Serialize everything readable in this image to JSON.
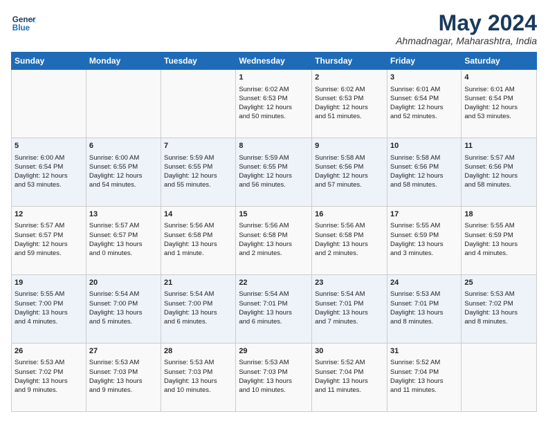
{
  "header": {
    "logo_line1": "General",
    "logo_line2": "Blue",
    "month_title": "May 2024",
    "location": "Ahmadnagar, Maharashtra, India"
  },
  "days_of_week": [
    "Sunday",
    "Monday",
    "Tuesday",
    "Wednesday",
    "Thursday",
    "Friday",
    "Saturday"
  ],
  "weeks": [
    [
      {
        "day": "",
        "info": ""
      },
      {
        "day": "",
        "info": ""
      },
      {
        "day": "",
        "info": ""
      },
      {
        "day": "1",
        "info": "Sunrise: 6:02 AM\nSunset: 6:53 PM\nDaylight: 12 hours\nand 50 minutes."
      },
      {
        "day": "2",
        "info": "Sunrise: 6:02 AM\nSunset: 6:53 PM\nDaylight: 12 hours\nand 51 minutes."
      },
      {
        "day": "3",
        "info": "Sunrise: 6:01 AM\nSunset: 6:54 PM\nDaylight: 12 hours\nand 52 minutes."
      },
      {
        "day": "4",
        "info": "Sunrise: 6:01 AM\nSunset: 6:54 PM\nDaylight: 12 hours\nand 53 minutes."
      }
    ],
    [
      {
        "day": "5",
        "info": "Sunrise: 6:00 AM\nSunset: 6:54 PM\nDaylight: 12 hours\nand 53 minutes."
      },
      {
        "day": "6",
        "info": "Sunrise: 6:00 AM\nSunset: 6:55 PM\nDaylight: 12 hours\nand 54 minutes."
      },
      {
        "day": "7",
        "info": "Sunrise: 5:59 AM\nSunset: 6:55 PM\nDaylight: 12 hours\nand 55 minutes."
      },
      {
        "day": "8",
        "info": "Sunrise: 5:59 AM\nSunset: 6:55 PM\nDaylight: 12 hours\nand 56 minutes."
      },
      {
        "day": "9",
        "info": "Sunrise: 5:58 AM\nSunset: 6:56 PM\nDaylight: 12 hours\nand 57 minutes."
      },
      {
        "day": "10",
        "info": "Sunrise: 5:58 AM\nSunset: 6:56 PM\nDaylight: 12 hours\nand 58 minutes."
      },
      {
        "day": "11",
        "info": "Sunrise: 5:57 AM\nSunset: 6:56 PM\nDaylight: 12 hours\nand 58 minutes."
      }
    ],
    [
      {
        "day": "12",
        "info": "Sunrise: 5:57 AM\nSunset: 6:57 PM\nDaylight: 12 hours\nand 59 minutes."
      },
      {
        "day": "13",
        "info": "Sunrise: 5:57 AM\nSunset: 6:57 PM\nDaylight: 13 hours\nand 0 minutes."
      },
      {
        "day": "14",
        "info": "Sunrise: 5:56 AM\nSunset: 6:58 PM\nDaylight: 13 hours\nand 1 minute."
      },
      {
        "day": "15",
        "info": "Sunrise: 5:56 AM\nSunset: 6:58 PM\nDaylight: 13 hours\nand 2 minutes."
      },
      {
        "day": "16",
        "info": "Sunrise: 5:56 AM\nSunset: 6:58 PM\nDaylight: 13 hours\nand 2 minutes."
      },
      {
        "day": "17",
        "info": "Sunrise: 5:55 AM\nSunset: 6:59 PM\nDaylight: 13 hours\nand 3 minutes."
      },
      {
        "day": "18",
        "info": "Sunrise: 5:55 AM\nSunset: 6:59 PM\nDaylight: 13 hours\nand 4 minutes."
      }
    ],
    [
      {
        "day": "19",
        "info": "Sunrise: 5:55 AM\nSunset: 7:00 PM\nDaylight: 13 hours\nand 4 minutes."
      },
      {
        "day": "20",
        "info": "Sunrise: 5:54 AM\nSunset: 7:00 PM\nDaylight: 13 hours\nand 5 minutes."
      },
      {
        "day": "21",
        "info": "Sunrise: 5:54 AM\nSunset: 7:00 PM\nDaylight: 13 hours\nand 6 minutes."
      },
      {
        "day": "22",
        "info": "Sunrise: 5:54 AM\nSunset: 7:01 PM\nDaylight: 13 hours\nand 6 minutes."
      },
      {
        "day": "23",
        "info": "Sunrise: 5:54 AM\nSunset: 7:01 PM\nDaylight: 13 hours\nand 7 minutes."
      },
      {
        "day": "24",
        "info": "Sunrise: 5:53 AM\nSunset: 7:01 PM\nDaylight: 13 hours\nand 8 minutes."
      },
      {
        "day": "25",
        "info": "Sunrise: 5:53 AM\nSunset: 7:02 PM\nDaylight: 13 hours\nand 8 minutes."
      }
    ],
    [
      {
        "day": "26",
        "info": "Sunrise: 5:53 AM\nSunset: 7:02 PM\nDaylight: 13 hours\nand 9 minutes."
      },
      {
        "day": "27",
        "info": "Sunrise: 5:53 AM\nSunset: 7:03 PM\nDaylight: 13 hours\nand 9 minutes."
      },
      {
        "day": "28",
        "info": "Sunrise: 5:53 AM\nSunset: 7:03 PM\nDaylight: 13 hours\nand 10 minutes."
      },
      {
        "day": "29",
        "info": "Sunrise: 5:53 AM\nSunset: 7:03 PM\nDaylight: 13 hours\nand 10 minutes."
      },
      {
        "day": "30",
        "info": "Sunrise: 5:52 AM\nSunset: 7:04 PM\nDaylight: 13 hours\nand 11 minutes."
      },
      {
        "day": "31",
        "info": "Sunrise: 5:52 AM\nSunset: 7:04 PM\nDaylight: 13 hours\nand 11 minutes."
      },
      {
        "day": "",
        "info": ""
      }
    ]
  ]
}
